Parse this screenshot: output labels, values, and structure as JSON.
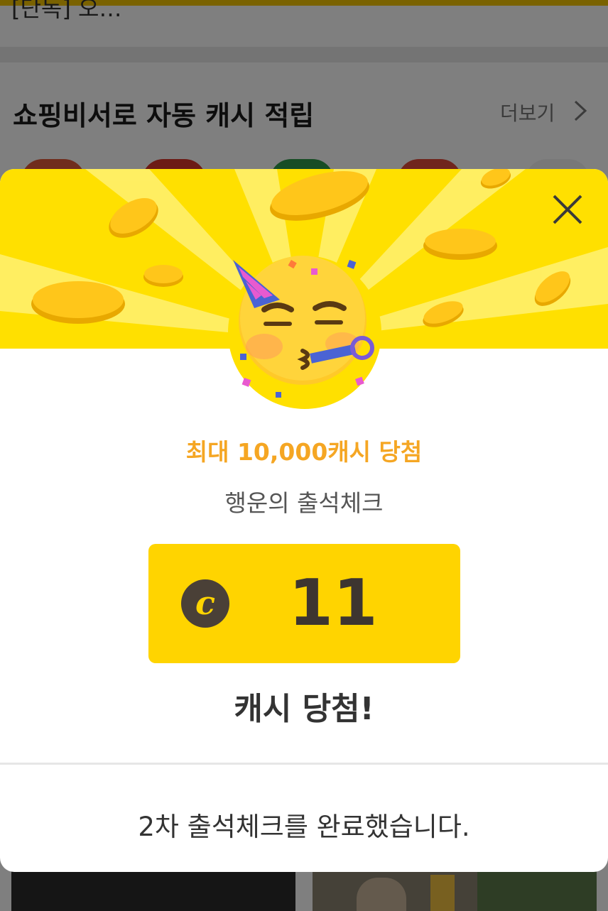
{
  "background": {
    "headline_fragment": "[단독] 오…",
    "section_title": "쇼핑비서로 자동 캐시 적립",
    "more_label": "더보기",
    "more_icon": "chevron-right-icon"
  },
  "modal": {
    "close_icon": "close-icon",
    "emoji": "party-face-emoji",
    "promo_headline": "최대 10,000캐시 당첨",
    "event_name": "행운의 출석체크",
    "cash_icon_letter": "c",
    "cash_amount": "11",
    "result_text": "캐시 당첨!",
    "footer_message": "2차 출석체크를 완료했습니다."
  },
  "colors": {
    "banner_yellow": "#ffe000",
    "cash_box": "#ffd400",
    "headline_orange": "#f5a623",
    "coin_dark": "#4a4037"
  }
}
